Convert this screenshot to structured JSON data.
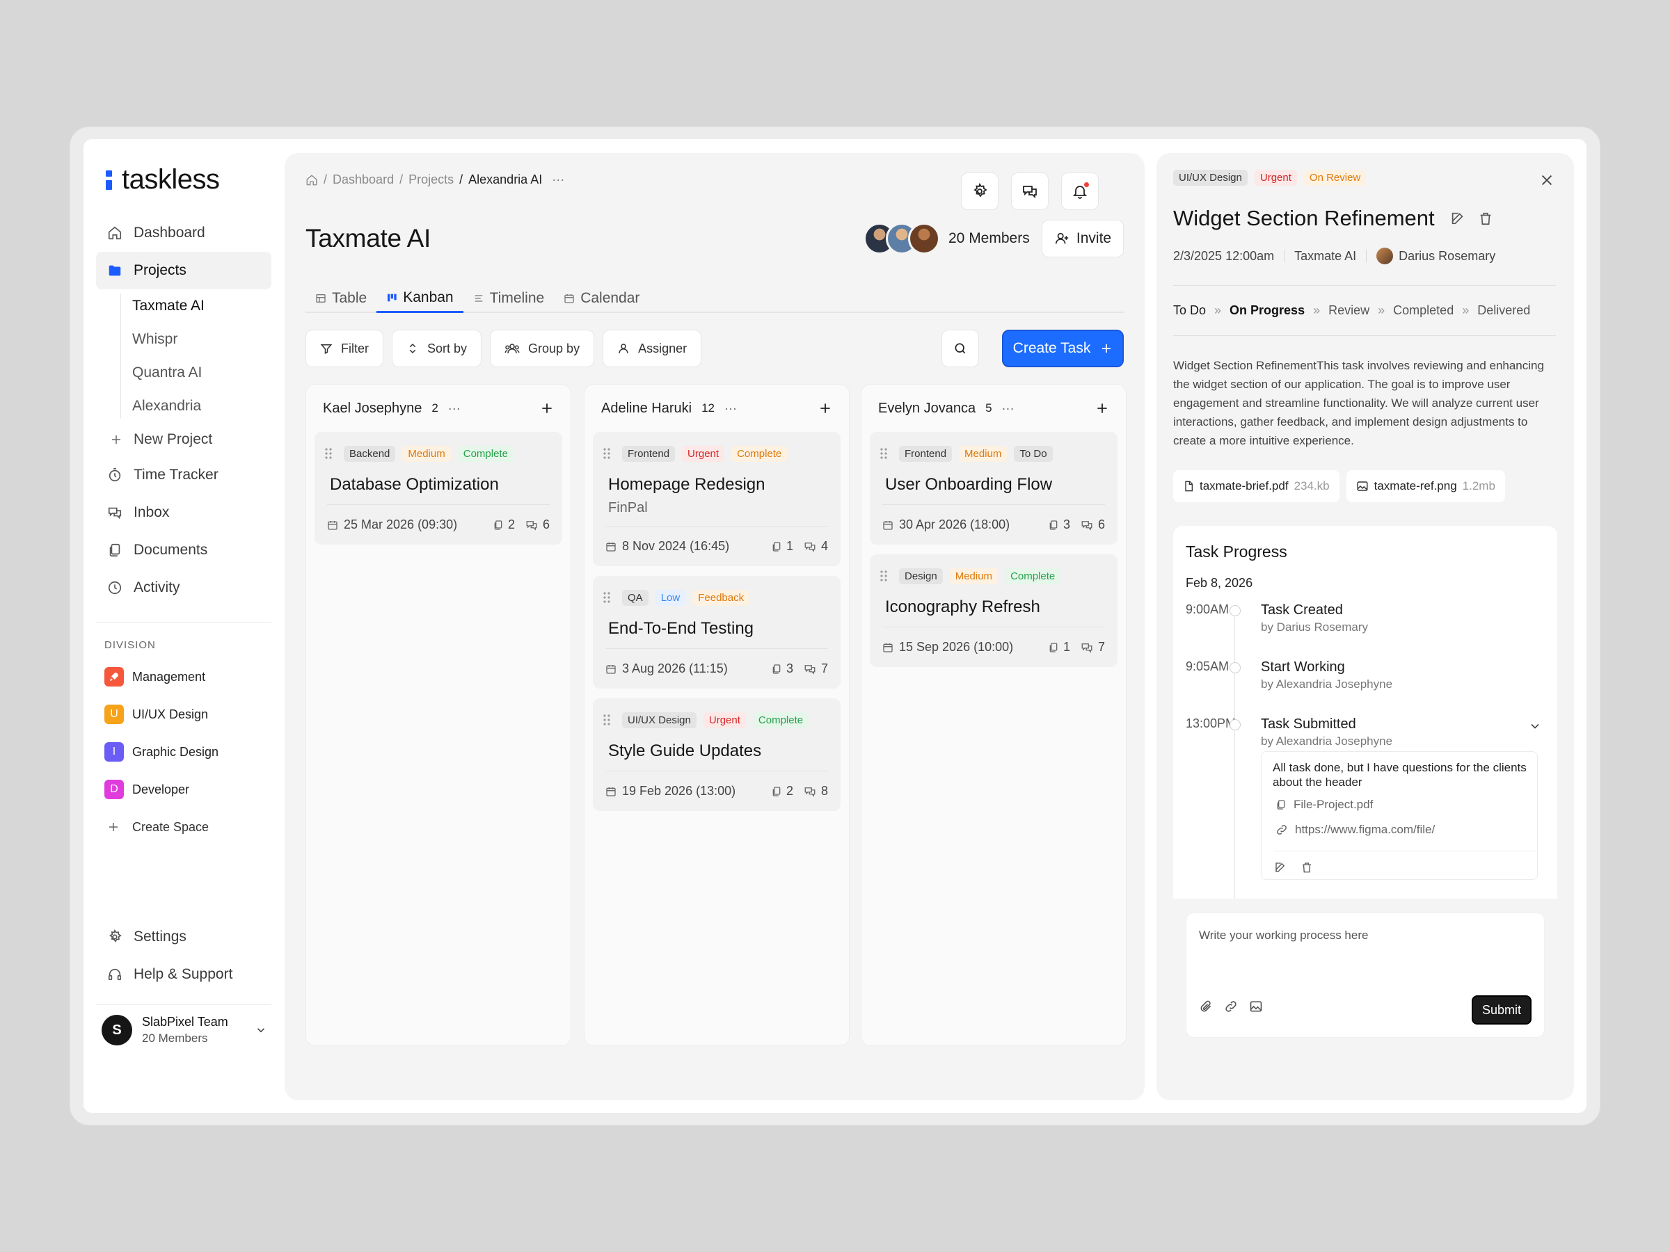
{
  "app": {
    "name": "taskless"
  },
  "sidebar": {
    "nav": [
      {
        "label": "Dashboard",
        "icon": "home-icon"
      },
      {
        "label": "Projects",
        "icon": "folder-icon",
        "active": true
      }
    ],
    "projects": [
      "Taxmate AI",
      "Whispr",
      "Quantra AI",
      "Alexandria"
    ],
    "new_project": "New Project",
    "nav2": [
      {
        "label": "Time Tracker",
        "icon": "timer-icon"
      },
      {
        "label": "Inbox",
        "icon": "chat-icon"
      },
      {
        "label": "Documents",
        "icon": "documents-icon"
      },
      {
        "label": "Activity",
        "icon": "clock-icon"
      }
    ],
    "division_title": "DIVISION",
    "divisions": [
      {
        "label": "Management",
        "letter": "",
        "color": "#f5573b",
        "icon": "rocket-icon"
      },
      {
        "label": "UI/UX Design",
        "letter": "U",
        "color": "#f6a21a"
      },
      {
        "label": "Graphic Design",
        "letter": "I",
        "color": "#6b5cf6"
      },
      {
        "label": "Developer",
        "letter": "D",
        "color": "#e03bdd"
      }
    ],
    "create_space": "Create Space",
    "settings": "Settings",
    "help": "Help & Support",
    "team": {
      "name": "SlabPixel Team",
      "members": "20 Members"
    }
  },
  "main": {
    "breadcrumb": [
      "Dashboard",
      "Projects",
      "Alexandria AI"
    ],
    "title": "Taxmate AI",
    "members": "20 Members",
    "invite": "Invite",
    "tabs": [
      "Table",
      "Kanban",
      "Timeline",
      "Calendar"
    ],
    "active_tab": "Kanban",
    "toolbar": {
      "filter": "Filter",
      "sort": "Sort by",
      "group": "Group by",
      "assigner": "Assigner"
    },
    "create_task": "Create Task",
    "columns": [
      {
        "name": "Kael Josephyne",
        "count": "2",
        "cards": [
          {
            "tags": [
              [
                "Backend",
                "plain"
              ],
              [
                "Medium",
                "medium"
              ],
              [
                "Complete",
                "complete"
              ]
            ],
            "title": "Database Optimization",
            "subtitle": "",
            "date": "25 Mar 2026 (09:30)",
            "files": "2",
            "comments": "6"
          }
        ]
      },
      {
        "name": "Adeline Haruki",
        "count": "12",
        "cards": [
          {
            "tags": [
              [
                "Frontend",
                "plain"
              ],
              [
                "Urgent",
                "urgent"
              ],
              [
                "Complete",
                "medium"
              ]
            ],
            "title": "Homepage Redesign",
            "subtitle": "FinPal",
            "date": "8 Nov 2024 (16:45)",
            "files": "1",
            "comments": "4"
          },
          {
            "tags": [
              [
                "QA",
                "plain"
              ],
              [
                "Low",
                "low"
              ],
              [
                "Feedback",
                "feedback"
              ]
            ],
            "title": "End-To-End Testing",
            "subtitle": "",
            "date": "3 Aug 2026 (11:15)",
            "files": "3",
            "comments": "7"
          },
          {
            "tags": [
              [
                "UI/UX Design",
                "plain"
              ],
              [
                "Urgent",
                "urgent"
              ],
              [
                "Complete",
                "complete"
              ]
            ],
            "title": "Style Guide Updates",
            "subtitle": "",
            "date": "19 Feb 2026 (13:00)",
            "files": "2",
            "comments": "8"
          }
        ]
      },
      {
        "name": "Evelyn Jovanca",
        "count": "5",
        "cards": [
          {
            "tags": [
              [
                "Frontend",
                "plain"
              ],
              [
                "Medium",
                "medium"
              ],
              [
                "To Do",
                "plain"
              ]
            ],
            "title": "User Onboarding Flow",
            "subtitle": "",
            "date": "30 Apr 2026 (18:00)",
            "files": "3",
            "comments": "6"
          },
          {
            "tags": [
              [
                "Design",
                "plain"
              ],
              [
                "Medium",
                "medium"
              ],
              [
                "Complete",
                "complete"
              ]
            ],
            "title": "Iconography Refresh",
            "subtitle": "",
            "date": "15 Sep 2026 (10:00)",
            "files": "1",
            "comments": "7"
          }
        ]
      }
    ]
  },
  "detail": {
    "tags": [
      [
        "UI/UX Design",
        "plain"
      ],
      [
        "Urgent",
        "urgent"
      ],
      [
        "On Review",
        "review"
      ]
    ],
    "title": "Widget Section Refinement",
    "date": "2/3/2025 12:00am",
    "project": "Taxmate AI",
    "assignee": "Darius Rosemary",
    "steps": [
      "To Do",
      "On Progress",
      "Review",
      "Completed",
      "Delivered"
    ],
    "current_step": "On Progress",
    "description": "Widget Section RefinementThis task involves reviewing and enhancing the widget section of our application. The goal is to improve user engagement and streamline functionality. We will analyze current user interactions, gather feedback, and implement design adjustments to create a more intuitive experience.",
    "files": [
      {
        "name": "taxmate-brief.pdf",
        "size": "234.kb",
        "icon": "document-icon"
      },
      {
        "name": "taxmate-ref.png",
        "size": "1.2mb",
        "icon": "image-icon"
      }
    ],
    "progress": {
      "title": "Task Progress",
      "date": "Feb 8, 2026",
      "events": [
        {
          "time": "9:00AM",
          "name": "Task Created",
          "by": "by Darius Rosemary"
        },
        {
          "time": "9:05AM",
          "name": "Start Working",
          "by": "by Alexandria Josephyne"
        },
        {
          "time": "13:00PM",
          "name": "Task Submitted",
          "by": "by Alexandria Josephyne"
        }
      ],
      "note": "All task done, but I have questions for the clients about the header",
      "note_file": "File-Project.pdf",
      "note_link": "https://www.figma.com/file/"
    },
    "composer": {
      "placeholder": "Write your working process here",
      "submit": "Submit"
    }
  },
  "colors": {
    "accent": "#1c6dff",
    "urgent": "#d42424",
    "medium": "#dc7a0c",
    "complete": "#24a04a",
    "low": "#3a86f7"
  }
}
